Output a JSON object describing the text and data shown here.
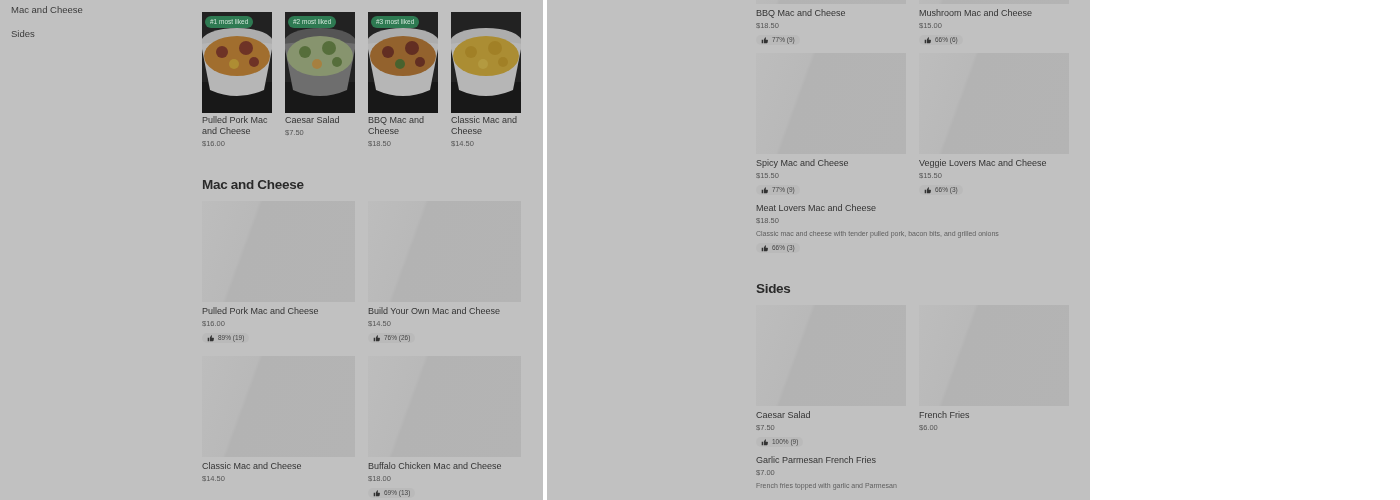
{
  "left_panel": {
    "sidebar": {
      "items": [
        {
          "label": "Mac and Cheese"
        },
        {
          "label": "Sides"
        }
      ]
    },
    "featured": [
      {
        "badge": "#1 most liked",
        "name": "Pulled Pork Mac and Cheese",
        "price": "$16.00"
      },
      {
        "badge": "#2 most liked",
        "name": "Caesar Salad",
        "price": "$7.50"
      },
      {
        "badge": "#3 most liked",
        "name": "BBQ Mac and Cheese",
        "price": "$18.50"
      },
      {
        "name": "Classic Mac and Cheese",
        "price": "$14.50"
      }
    ],
    "section": {
      "title": "Mac and Cheese",
      "items": [
        {
          "kind": "image_card",
          "name": "Pulled Pork Mac and Cheese",
          "price": "$16.00",
          "rating": "89% (19)"
        },
        {
          "kind": "image_card",
          "name": "Build Your Own Mac and Cheese",
          "price": "$14.50",
          "rating": "76% (26)"
        },
        {
          "kind": "image_card",
          "name": "Classic Mac and Cheese",
          "price": "$14.50"
        },
        {
          "kind": "image_card",
          "name": "Buffalo Chicken Mac and Cheese",
          "price": "$18.00",
          "rating": "69% (13)"
        }
      ]
    }
  },
  "right_panel": {
    "sections": [
      {
        "items": [
          {
            "kind": "image_card",
            "name": "BBQ Mac and Cheese",
            "price": "$18.50",
            "rating": "77% (9)"
          },
          {
            "kind": "image_card",
            "name": "Mushroom Mac and Cheese",
            "price": "$15.00",
            "rating": "66% (6)"
          },
          {
            "kind": "image_card",
            "name": "Spicy Mac and Cheese",
            "price": "$15.50",
            "rating": "77% (9)"
          },
          {
            "kind": "image_card",
            "name": "Veggie Lovers Mac and Cheese",
            "price": "$15.50",
            "rating": "66% (3)"
          },
          {
            "kind": "text_row",
            "name": "Meat Lovers Mac and Cheese",
            "price": "$18.50",
            "description": "Classic mac and cheese with tender pulled pork, bacon bits, and grilled onions",
            "rating": "66% (3)"
          }
        ]
      },
      {
        "title": "Sides",
        "items": [
          {
            "kind": "image_card",
            "name": "Caesar Salad",
            "price": "$7.50",
            "rating": "100% (9)"
          },
          {
            "kind": "image_card",
            "name": "French Fries",
            "price": "$6.00"
          },
          {
            "kind": "text_row",
            "name": "Garlic Parmesan French Fries",
            "price": "$7.00",
            "description": "French fries topped with garlic and Parmesan"
          }
        ]
      }
    ]
  }
}
